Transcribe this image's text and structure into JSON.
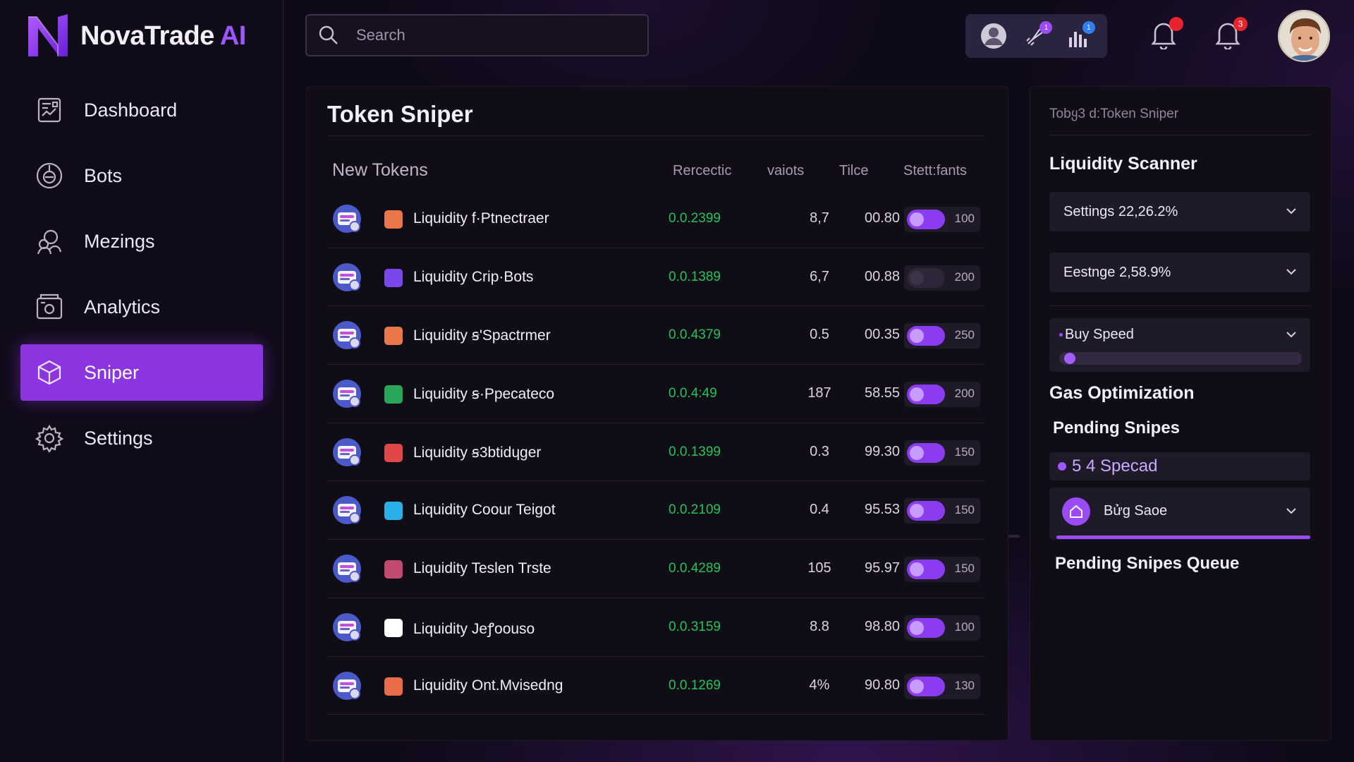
{
  "app": {
    "name": "NovaTrade",
    "suffix": "AI"
  },
  "sidebar": {
    "items": [
      {
        "label": "Dashboard",
        "icon": "dashboard-icon"
      },
      {
        "label": "Bots",
        "icon": "bot-icon"
      },
      {
        "label": "Mezings",
        "icon": "meetings-icon"
      },
      {
        "label": "Analytics",
        "icon": "analytics-icon"
      },
      {
        "label": "Sniper",
        "icon": "cube-icon",
        "active": true
      },
      {
        "label": "Settings",
        "icon": "gear-icon"
      }
    ]
  },
  "search": {
    "placeholder": "Search",
    "value": ""
  },
  "topbar": {
    "notif_badge_1": "",
    "notif_badge_2": "3",
    "icon_badges": [
      "1",
      "1"
    ]
  },
  "main": {
    "title": "Token Sniper",
    "columns": [
      "New Tokens",
      "Rercectic",
      "vaiots",
      "Tilce",
      "Stett:fants"
    ],
    "rows": [
      {
        "name": "Liquidity f·Ptnectraer",
        "price": "0.0.2399",
        "v2": "8,7",
        "v3": "00.80",
        "on": true,
        "val": "100",
        "pair_color": "#e9774a"
      },
      {
        "name": "Liquidity Crip·Bots",
        "price": "0.0.1389",
        "v2": "6,7",
        "v3": "00.88",
        "on": false,
        "val": "200",
        "pair_color": "#7a48e8"
      },
      {
        "name": "Liquidity ꞩ'Spactrmer",
        "price": "0.0.4379",
        "v2": "0.5",
        "v3": "00.35",
        "on": true,
        "val": "250",
        "pair_color": "#e9774a"
      },
      {
        "name": "Liquidity ꞩ·Ppecateco",
        "price": "0.0.4:49",
        "v2": "187",
        "v3": "58.55",
        "on": true,
        "val": "200",
        "pair_color": "#2aa65a"
      },
      {
        "name": "Liquidity ꞩ3btidɥger",
        "price": "0.0.1399",
        "v2": "0.3",
        "v3": "99.30",
        "on": true,
        "val": "150",
        "pair_color": "#e04848"
      },
      {
        "name": "Liquidity Coour Teigot",
        "price": "0.0.2109",
        "v2": "0.4",
        "v3": "95.53",
        "on": true,
        "val": "150",
        "pair_color": "#2ab0e8"
      },
      {
        "name": "Liquidity Teslen Trste",
        "price": "0.0.4289",
        "v2": "105",
        "v3": "95.97",
        "on": true,
        "val": "150",
        "pair_color": "#c24a70"
      },
      {
        "name": "Liquidity Jeꝭoouso",
        "price": "0.0.3159",
        "v2": "8.8",
        "v3": "98.80",
        "on": true,
        "val": "100",
        "pair_color": "#ffffff"
      },
      {
        "name": "Liquidity Ont.Mvisedng",
        "price": "0.0.1269",
        "v2": "4%",
        "v3": "90.80",
        "on": true,
        "val": "130",
        "pair_color": "#e86b4a"
      }
    ]
  },
  "side": {
    "breadcrumb": "Tobყ3 d:Token Sniper",
    "liquidity_scanner": "Liquidity Scanner",
    "settings_dd": "Settings  22,26.2%",
    "eestnge_dd": "Eestnge  2,58.9%",
    "buy_speed": "Buy Speed",
    "buy_speed_level": 0.02,
    "gas_optimization": "Gas Optimization",
    "pending_snipes": "Pending Snipes",
    "spread": "5 4 Specad",
    "buy_saoe": "Bửg Saoe",
    "progress": 1.0,
    "pending_queue": "Pending Snipes Queue"
  },
  "colors": {
    "accent": "#8a35e0",
    "positive": "#22c45a",
    "bg": "#0f0a19"
  }
}
